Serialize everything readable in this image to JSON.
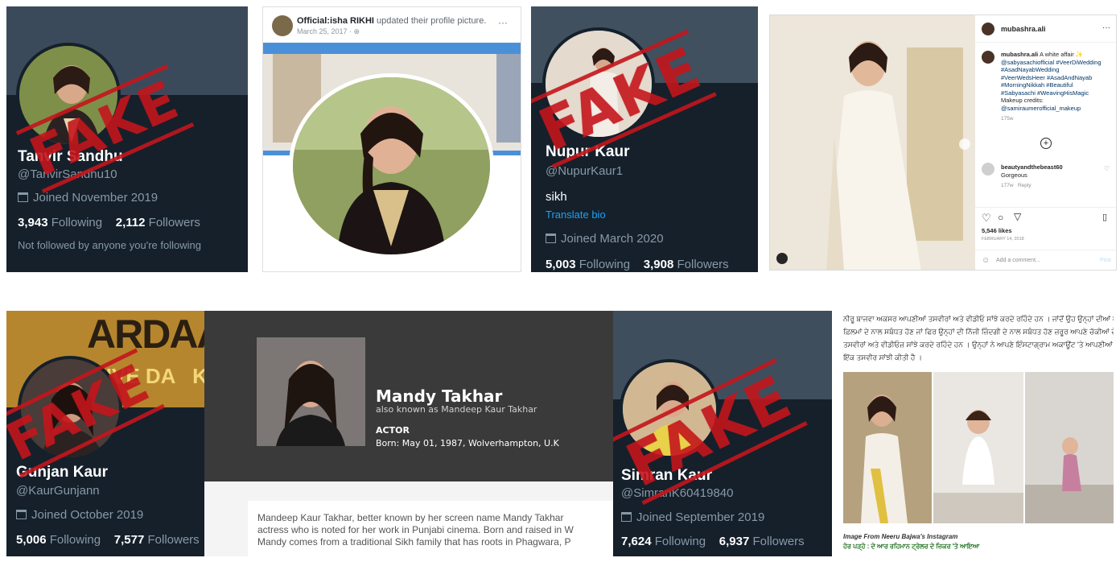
{
  "stamp_text": "FAKE",
  "colors": {
    "twitter_dark": "#15202b",
    "stamp_red": "#c4161c",
    "link_blue": "#1da1f2"
  },
  "tw1": {
    "name": "Tanvir Sandhu",
    "handle": "@TanvirSandhu10",
    "joined": "Joined November 2019",
    "following_count": "3,943",
    "following_label": "Following",
    "followers_count": "2,112",
    "followers_label": "Followers",
    "note": "Not followed by anyone you're following"
  },
  "fb": {
    "page_name": "Official:isha RIKHI",
    "action": "updated their profile picture.",
    "date": "March 25, 2017 · ",
    "globe_icon": "globe-icon",
    "more": "···"
  },
  "tw2": {
    "name": "Nupur Kaur",
    "handle": "@NupurKaur1",
    "bio": "sikh",
    "translate": "Translate bio",
    "joined": "Joined March 2020",
    "following_count": "5,003",
    "following_label": "Following",
    "followers_count": "3,908",
    "followers_label": "Followers"
  },
  "ig": {
    "username": "mubashra.ali",
    "more": "···",
    "caption_user": "mubashra.ali",
    "caption_text": "A white affair ✨",
    "tags": [
      "@sabyasachiofficial #VeerDiWedding",
      "#AsadNayabWedding",
      "#VeerWedsHeer #AsadAndNayab",
      "#MorningNikkah #Beautiful",
      "#Sabyasachi #WeavingHisMagic"
    ],
    "credits_label": "Makeup credits:",
    "credits_user": "@samiraumerofficial_makeup",
    "caption_age": "175w",
    "comment_user": "beautyandthebeast60",
    "comment_text": "Gorgeous",
    "comment_age": "177w",
    "comment_reply": "Reply",
    "likes": "5,546 likes",
    "date": "FEBRUARY 14, 2018",
    "add_comment": "Add a comment...",
    "post": "Post"
  },
  "tw3": {
    "name": "Gunjan Kaur",
    "handle": "@KaurGunjann",
    "banner_text": "ARDAAS",
    "banner_sub": "KIVE DA   KHIYA",
    "joined": "Joined October 2019",
    "following_count": "5,006",
    "following_label": "Following",
    "followers_count": "7,577",
    "followers_label": "Followers"
  },
  "mandy": {
    "name": "Mandy Takhar",
    "aka": "also known as Mandeep Kaur Takhar",
    "role": "ACTOR",
    "born": "Born: May 01, 1987, Wolverhampton, U.K",
    "bio_lines": [
      "Mandeep Kaur Takhar, better known by her screen name Mandy Takhar",
      "actress who is noted for her work in Punjabi cinema. Born and raised in W",
      "Mandy comes from a traditional Sikh family that has roots in Phagwara, P"
    ]
  },
  "tw4": {
    "name": "Simran Kaur",
    "handle": "@SimranK60419840",
    "joined": "Joined September 2019",
    "following_count": "7,624",
    "following_label": "Following",
    "followers_count": "6,937",
    "followers_label": "Followers"
  },
  "neeru": {
    "text_lines": [
      "ਨੀਰੂ ਬਾਜਵਾ ਅਕਸਰ ਆਪਣੀਆਂ ਤਸਵੀਰਾਂ ਅਤੇ ਵੀਡੀਓ ਸਾਂਝੇ ਕਰਦੇ ਰਹਿੰਦੇ ਹਨ । ਜਾਂਦੋਂ ਉਹ ਉਨ੍ਹਾਂ ਦੀਆਂ ਆਉਣ ਵਾਲੀਆਂ",
      "ਫ਼ਿਲਮਾਂ ਦੇ ਨਾਲ ਸਬੰਧਤ ਹੋਣ ਜਾਂ ਫਿਰ ਉਨ੍ਹਾਂ ਦੀ ਨਿੱਜੀ ਜ਼ਿੰਦਗੀ ਦੇ ਨਾਲ ਸਬੰਧਤ ਹੋਣ ਜ਼ਰੂਰ ਆਪਣੇ ਚੱਕੀਆਂ ਦੇ ਨਾਲ ਅਕਸਰ",
      "ਤਸਵੀਰਾਂ ਅਤੇ ਵੀਡੀਓਜ਼ ਸਾਂਝੇ ਕਰਦੇ ਰਹਿੰਦੇ ਹਨ । ਉਨ੍ਹਾਂ ਨੇ ਆਪਣੇ ਇੰਸਟਾਗ੍ਰਾਮ ਅਕਾਊਂਟ 'ਤੇ ਆਪਣੀਆਂ ਜੁੜਵਾ ਬੇਟੀਆਂ ਦੀ",
      "ਇੱਕ ਤਸਵੀਰ ਸਾਂਝੀ ਕੀਤੀ ਹੈ ।"
    ],
    "caption": "Image From Neeru Bajwa's Instagram",
    "read_more": "ਹੋਰ ਪੜ੍ਹੋ : ਦੇ ਆਰ ਰਹਿਮਾਨ ਟ੍ਰੇਲਰ ਦੇ ਜ਼ਿਕਰ 'ਤੇ ਆਇਆ"
  }
}
